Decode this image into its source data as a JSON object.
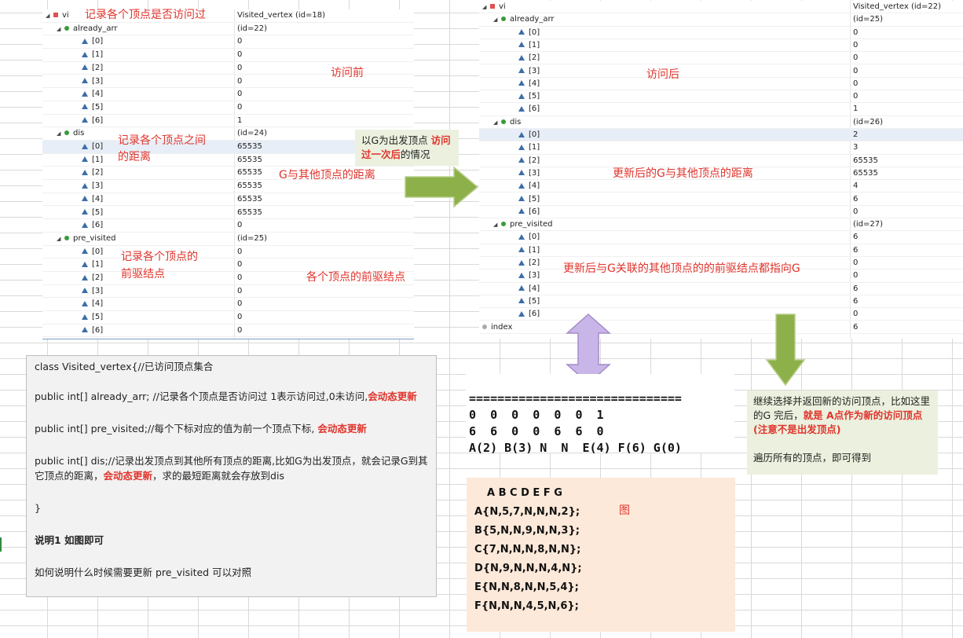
{
  "left_tree": {
    "rows": [
      {
        "name": "vi",
        "value": "Visited_vertex  (id=18)",
        "icon": "red-square",
        "level": 0
      },
      {
        "name": "already_arr",
        "value": "(id=22)",
        "icon": "green-dot",
        "level": 1
      },
      {
        "name": "[0]",
        "value": "0",
        "icon": "triangle",
        "level": 2
      },
      {
        "name": "[1]",
        "value": "0",
        "icon": "triangle",
        "level": 2
      },
      {
        "name": "[2]",
        "value": "0",
        "icon": "triangle",
        "level": 2
      },
      {
        "name": "[3]",
        "value": "0",
        "icon": "triangle",
        "level": 2
      },
      {
        "name": "[4]",
        "value": "0",
        "icon": "triangle",
        "level": 2
      },
      {
        "name": "[5]",
        "value": "0",
        "icon": "triangle",
        "level": 2
      },
      {
        "name": "[6]",
        "value": "1",
        "icon": "triangle",
        "level": 2
      },
      {
        "name": "dis",
        "value": "(id=24)",
        "icon": "green-dot",
        "level": 1
      },
      {
        "name": "[0]",
        "value": "65535",
        "icon": "triangle",
        "level": 2,
        "selected": true
      },
      {
        "name": "[1]",
        "value": "65535",
        "icon": "triangle",
        "level": 2
      },
      {
        "name": "[2]",
        "value": "65535",
        "icon": "triangle",
        "level": 2
      },
      {
        "name": "[3]",
        "value": "65535",
        "icon": "triangle",
        "level": 2
      },
      {
        "name": "[4]",
        "value": "65535",
        "icon": "triangle",
        "level": 2
      },
      {
        "name": "[5]",
        "value": "65535",
        "icon": "triangle",
        "level": 2
      },
      {
        "name": "[6]",
        "value": "0",
        "icon": "triangle",
        "level": 2
      },
      {
        "name": "pre_visited",
        "value": "(id=25)",
        "icon": "green-dot",
        "level": 1
      },
      {
        "name": "[0]",
        "value": "0",
        "icon": "triangle",
        "level": 2
      },
      {
        "name": "[1]",
        "value": "0",
        "icon": "triangle",
        "level": 2
      },
      {
        "name": "[2]",
        "value": "0",
        "icon": "triangle",
        "level": 2
      },
      {
        "name": "[3]",
        "value": "0",
        "icon": "triangle",
        "level": 2
      },
      {
        "name": "[4]",
        "value": "0",
        "icon": "triangle",
        "level": 2
      },
      {
        "name": "[5]",
        "value": "0",
        "icon": "triangle",
        "level": 2
      },
      {
        "name": "[6]",
        "value": "0",
        "icon": "triangle",
        "level": 2
      }
    ]
  },
  "right_tree": {
    "rows": [
      {
        "name": "vi",
        "value": "Visited_vertex  (id=22)",
        "icon": "red-square",
        "level": 0
      },
      {
        "name": "already_arr",
        "value": "(id=25)",
        "icon": "green-dot",
        "level": 1
      },
      {
        "name": "[0]",
        "value": "0",
        "icon": "triangle",
        "level": 2
      },
      {
        "name": "[1]",
        "value": "0",
        "icon": "triangle",
        "level": 2
      },
      {
        "name": "[2]",
        "value": "0",
        "icon": "triangle",
        "level": 2
      },
      {
        "name": "[3]",
        "value": "0",
        "icon": "triangle",
        "level": 2
      },
      {
        "name": "[4]",
        "value": "0",
        "icon": "triangle",
        "level": 2
      },
      {
        "name": "[5]",
        "value": "0",
        "icon": "triangle",
        "level": 2
      },
      {
        "name": "[6]",
        "value": "1",
        "icon": "triangle",
        "level": 2
      },
      {
        "name": "dis",
        "value": "(id=26)",
        "icon": "green-dot",
        "level": 1
      },
      {
        "name": "[0]",
        "value": "2",
        "icon": "triangle",
        "level": 2,
        "selected": true
      },
      {
        "name": "[1]",
        "value": "3",
        "icon": "triangle",
        "level": 2
      },
      {
        "name": "[2]",
        "value": "65535",
        "icon": "triangle",
        "level": 2
      },
      {
        "name": "[3]",
        "value": "65535",
        "icon": "triangle",
        "level": 2
      },
      {
        "name": "[4]",
        "value": "4",
        "icon": "triangle",
        "level": 2
      },
      {
        "name": "[5]",
        "value": "6",
        "icon": "triangle",
        "level": 2
      },
      {
        "name": "[6]",
        "value": "0",
        "icon": "triangle",
        "level": 2
      },
      {
        "name": "pre_visited",
        "value": "(id=27)",
        "icon": "green-dot",
        "level": 1
      },
      {
        "name": "[0]",
        "value": "6",
        "icon": "triangle",
        "level": 2
      },
      {
        "name": "[1]",
        "value": "6",
        "icon": "triangle",
        "level": 2
      },
      {
        "name": "[2]",
        "value": "0",
        "icon": "triangle",
        "level": 2
      },
      {
        "name": "[3]",
        "value": "0",
        "icon": "triangle",
        "level": 2
      },
      {
        "name": "[4]",
        "value": "6",
        "icon": "triangle",
        "level": 2
      },
      {
        "name": "[5]",
        "value": "6",
        "icon": "triangle",
        "level": 2
      },
      {
        "name": "[6]",
        "value": "0",
        "icon": "triangle",
        "level": 2
      },
      {
        "name": "index",
        "value": "6",
        "icon": "grey-dot",
        "level": 0
      }
    ]
  },
  "annotations": {
    "left_visited": "记录各个顶点是否访问过",
    "before": "访问前",
    "left_dis_1": "记录各个顶点之间",
    "left_dis_2": "的距离",
    "g_dist": "G与其他顶点的距离",
    "pre_1": "记录各个顶点的",
    "pre_2": "前驱结点",
    "pre_each": "各个顶点的前驱结点",
    "after": "访问后",
    "updated_dist": "更新后的G与其他顶点的距离",
    "updated_pre": "更新后与G关联的其他顶点的的前驱结点都指向G",
    "graph": "图"
  },
  "callout": {
    "prefix": "以G为出发顶点 ",
    "highlight": "访问过一次后",
    "suffix": "的情况"
  },
  "code_box": {
    "l1": "class Visited_vertex{//已访问顶点集合",
    "l2": "public int[] already_arr; //记录各个顶点是否访问过 1表示访问过,0未访问,",
    "l2_red": "会动态更新",
    "l3": "public int[] pre_visited;//每个下标对应的值为前一个顶点下标, ",
    "l3_red": "会动态更新",
    "l4": "public int[] dis;//记录出发顶点到其他所有顶点的距离,比如G为出发顶点，就会记录G到其它顶点的距离，",
    "l4_red": "会动态更新",
    "l4_end": "，求的最短距离就会存放到dis",
    "l5": "}",
    "l6": "说明1 如图即可",
    "l7": "如何说明什么时候需要更新 pre_visited 可以对照"
  },
  "console": {
    "sep": "==============================",
    "line1": "0  0  0  0  0  0  1",
    "line2": "6  6  0  0  6  6  0",
    "line3": "A(2) B(3) N  N  E(4) F(6) G(0)"
  },
  "matrix": {
    "header": "A  B C D E  F  G",
    "rows": [
      "A{N,5,7,N,N,N,2};",
      "B{5,N,N,9,N,N,3};",
      "C{7,N,N,N,8,N,N};",
      "D{N,9,N,N,N,4,N};",
      "E{N,N,8,N,N,5,4};",
      "F{N,N,N,4,5,N,6};"
    ]
  },
  "note": {
    "p1": "继续选择并返回新的访问顶点，比如这里的G 完后，",
    "p1_red": "就是 A点作为新的访问顶点(注意不是出发顶点)",
    "p2": "遍历所有的顶点，即可得到"
  },
  "colors": {
    "annotation_red": "#e0342c",
    "arrow_green": "#8db04a",
    "arrow_purple": "#c9b6e8",
    "peach_bg": "#fde9d9",
    "note_bg": "#ebf1de"
  }
}
